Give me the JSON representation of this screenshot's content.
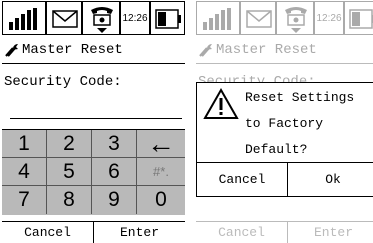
{
  "status": {
    "time": "12:26",
    "icons": [
      "signal-icon",
      "mail-icon",
      "phone-icon",
      "battery-icon"
    ]
  },
  "left": {
    "title": "Master Reset",
    "prompt": "Security Code:",
    "keys": [
      "1",
      "2",
      "3",
      "←",
      "4",
      "5",
      "6",
      "#*.",
      "7",
      "8",
      "9",
      "0"
    ],
    "cancel": "Cancel",
    "enter": "Enter"
  },
  "right": {
    "title": "Master Reset",
    "prompt": "Security Code:",
    "dialog": {
      "line1": "Reset Settings",
      "line2": "to Factory",
      "line3": "Default?",
      "cancel": "Cancel",
      "ok": "Ok"
    },
    "cancel": "Cancel",
    "enter": "Enter"
  }
}
